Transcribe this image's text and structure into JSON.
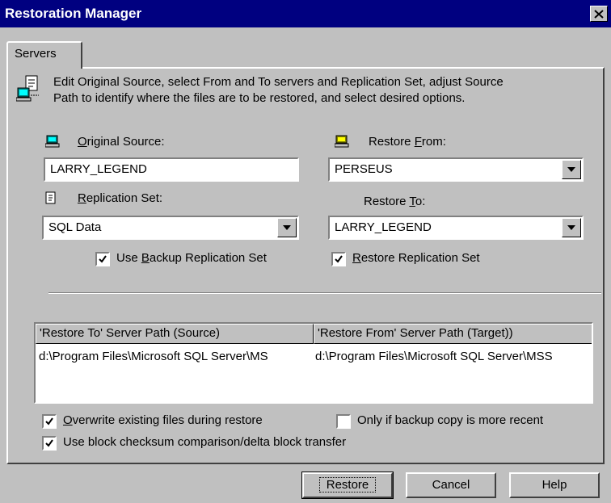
{
  "window": {
    "title": "Restoration Manager"
  },
  "tabs": [
    {
      "label": "Servers"
    }
  ],
  "instructions": {
    "line1": "Edit Original Source, select From and To servers and Replication Set, adjust Source",
    "line2": "Path to identify where the files are to be restored, and select desired options."
  },
  "original_source": {
    "label_pre": "",
    "label_key": "O",
    "label_post": "riginal Source:",
    "value": "LARRY_LEGEND"
  },
  "restore_from": {
    "label_pre": "Restore ",
    "label_key": "F",
    "label_post": "rom:",
    "value": "PERSEUS"
  },
  "replication_set": {
    "label_pre": "",
    "label_key": "R",
    "label_post": "eplication Set:",
    "value": "SQL Data"
  },
  "restore_to": {
    "label_pre": "Restore ",
    "label_key": "T",
    "label_post": "o:",
    "value": "LARRY_LEGEND"
  },
  "use_backup_set": {
    "label_pre": "Use ",
    "label_key": "B",
    "label_post": "ackup Replication Set",
    "checked": true
  },
  "restore_replication_set": {
    "label_pre": "",
    "label_key": "R",
    "label_post": "estore Replication Set",
    "checked": true
  },
  "paths_table": {
    "columns": [
      "'Restore To' Server Path (Source)",
      "'Restore From' Server Path (Target))"
    ],
    "rows": [
      [
        "d:\\Program Files\\Microsoft SQL Server\\MS",
        "d:\\Program Files\\Microsoft SQL Server\\MSS"
      ]
    ]
  },
  "overwrite": {
    "label_pre": "",
    "label_key": "O",
    "label_post": "verwrite existing files during restore",
    "checked": true
  },
  "only_if_recent": {
    "label": "Only if backup copy is more recent",
    "checked": false
  },
  "block_checksum": {
    "label": "Use block checksum comparison/delta block transfer",
    "checked": true
  },
  "buttons": {
    "restore": "Restore",
    "cancel": "Cancel",
    "help": "Help"
  }
}
